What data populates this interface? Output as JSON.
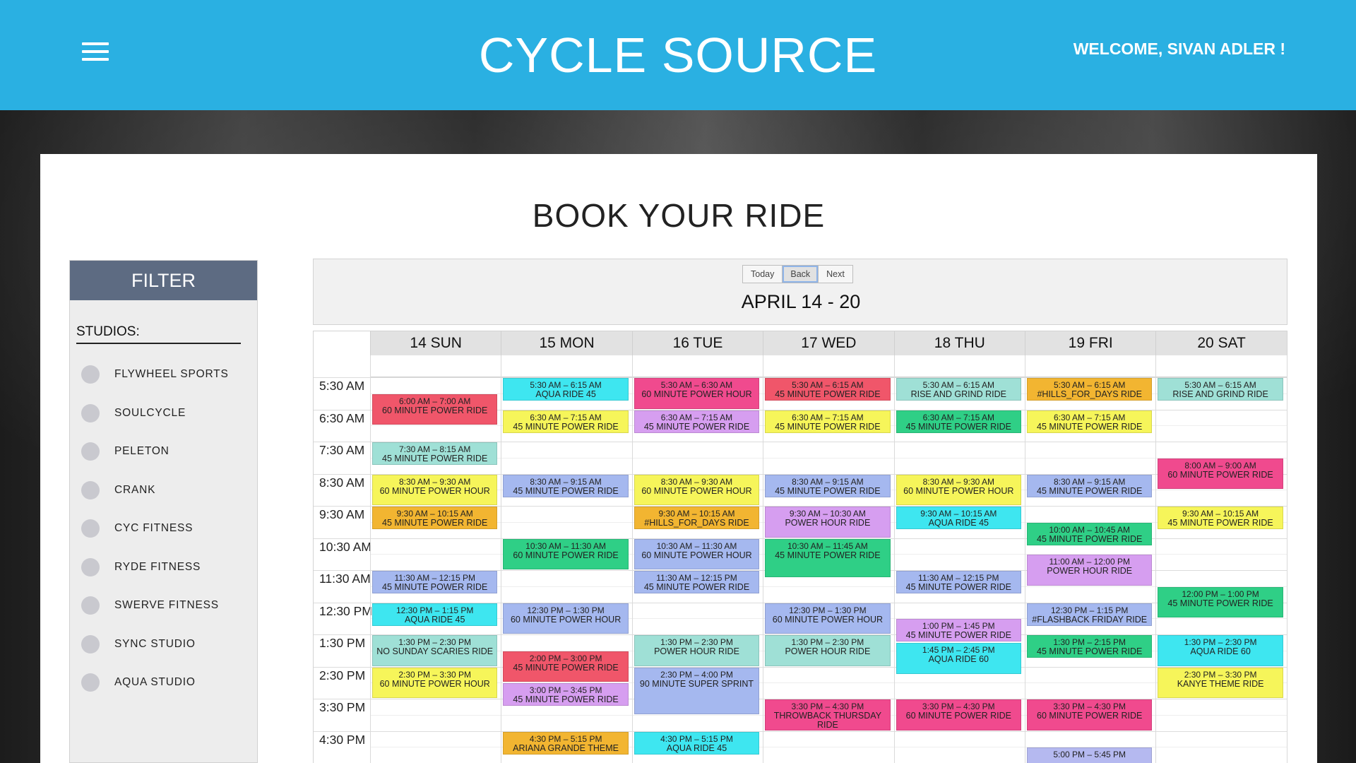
{
  "header": {
    "brand": "CYCLE SOURCE",
    "welcome": "WELCOME, SIVAN ADLER !"
  },
  "page": {
    "title": "BOOK YOUR RIDE"
  },
  "filter": {
    "heading": "FILTER",
    "studios_label": "STUDIOS:",
    "studios": [
      "FLYWHEEL SPORTS",
      "SOULCYCLE",
      "PELETON",
      "CRANK",
      "CYC FITNESS",
      "RYDE FITNESS",
      "SWERVE FITNESS",
      "SYNC STUDIO",
      "AQUA STUDIO"
    ]
  },
  "calendar": {
    "buttons": {
      "today": "Today",
      "back": "Back",
      "next": "Next"
    },
    "range": "APRIL 14 - 20",
    "days": [
      "14 SUN",
      "15 MON",
      "16 TUE",
      "17 WED",
      "18 THU",
      "19 FRI",
      "20 SAT"
    ],
    "times": [
      "5:30 AM",
      "6:30 AM",
      "7:30 AM",
      "8:30 AM",
      "9:30 AM",
      "10:30 AM",
      "11:30 AM",
      "12:30 PM",
      "1:30 PM",
      "2:30 PM",
      "3:30 PM",
      "4:30 PM"
    ],
    "colors": {
      "red": "#f0566a",
      "cyan": "#3ee6f0",
      "pink": "#f04a8e",
      "yellow": "#f6f55a",
      "orange": "#f2b531",
      "teal": "#9fe0d6",
      "green": "#2fcf86",
      "blue": "#a5b8ef",
      "purple": "#d69ef0",
      "lavender": "#b5b9f0"
    },
    "events": [
      {
        "day": 0,
        "start": 6.0,
        "end": 7.0,
        "time": "6:00 AM – 7:00 AM",
        "name": "60 MINUTE POWER RIDE",
        "color": "red"
      },
      {
        "day": 0,
        "start": 7.5,
        "end": 8.25,
        "time": "7:30 AM – 8:15 AM",
        "name": "45 MINUTE POWER RIDE",
        "color": "teal"
      },
      {
        "day": 0,
        "start": 8.5,
        "end": 9.5,
        "time": "8:30 AM – 9:30 AM",
        "name": "60 MINUTE POWER HOUR",
        "color": "yellow"
      },
      {
        "day": 0,
        "start": 9.5,
        "end": 10.25,
        "time": "9:30 AM – 10:15 AM",
        "name": "45 MINUTE POWER RIDE",
        "color": "orange"
      },
      {
        "day": 0,
        "start": 11.5,
        "end": 12.25,
        "time": "11:30 AM – 12:15 PM",
        "name": "45 MINUTE POWER RIDE",
        "color": "blue"
      },
      {
        "day": 0,
        "start": 12.5,
        "end": 13.25,
        "time": "12:30 PM – 1:15 PM",
        "name": "AQUA RIDE 45",
        "color": "cyan"
      },
      {
        "day": 0,
        "start": 13.5,
        "end": 14.5,
        "time": "1:30 PM – 2:30 PM",
        "name": "NO SUNDAY SCARIES RIDE",
        "color": "teal"
      },
      {
        "day": 0,
        "start": 14.5,
        "end": 15.5,
        "time": "2:30 PM – 3:30 PM",
        "name": "60 MINUTE POWER HOUR",
        "color": "yellow"
      },
      {
        "day": 1,
        "start": 5.5,
        "end": 6.25,
        "time": "5:30 AM – 6:15 AM",
        "name": "AQUA RIDE 45",
        "color": "cyan"
      },
      {
        "day": 1,
        "start": 6.5,
        "end": 7.25,
        "time": "6:30 AM – 7:15 AM",
        "name": "45 MINUTE POWER RIDE",
        "color": "yellow"
      },
      {
        "day": 1,
        "start": 8.5,
        "end": 9.25,
        "time": "8:30 AM – 9:15 AM",
        "name": "45 MINUTE POWER RIDE",
        "color": "blue"
      },
      {
        "day": 1,
        "start": 10.5,
        "end": 11.5,
        "time": "10:30 AM – 11:30 AM",
        "name": "60 MINUTE POWER RIDE",
        "color": "green"
      },
      {
        "day": 1,
        "start": 12.5,
        "end": 13.5,
        "time": "12:30 PM – 1:30 PM",
        "name": "60 MINUTE POWER HOUR",
        "color": "blue"
      },
      {
        "day": 1,
        "start": 14.0,
        "end": 15.0,
        "time": "2:00 PM – 3:00 PM",
        "name": "45 MINUTE POWER RIDE",
        "color": "red"
      },
      {
        "day": 1,
        "start": 15.0,
        "end": 15.75,
        "time": "3:00 PM – 3:45 PM",
        "name": "45 MINUTE POWER RIDE",
        "color": "purple"
      },
      {
        "day": 1,
        "start": 16.5,
        "end": 17.25,
        "time": "4:30 PM – 5:15 PM",
        "name": "ARIANA GRANDE THEME",
        "color": "orange"
      },
      {
        "day": 2,
        "start": 5.5,
        "end": 6.5,
        "time": "5:30 AM – 6:30 AM",
        "name": "60 MINUTE POWER HOUR",
        "color": "pink"
      },
      {
        "day": 2,
        "start": 6.5,
        "end": 7.25,
        "time": "6:30 AM – 7:15 AM",
        "name": "45 MINUTE POWER RIDE",
        "color": "purple"
      },
      {
        "day": 2,
        "start": 8.5,
        "end": 9.5,
        "time": "8:30 AM – 9:30 AM",
        "name": "60 MINUTE POWER HOUR",
        "color": "yellow"
      },
      {
        "day": 2,
        "start": 9.5,
        "end": 10.25,
        "time": "9:30 AM – 10:15 AM",
        "name": "#HILLS_FOR_DAYS RIDE",
        "color": "orange"
      },
      {
        "day": 2,
        "start": 10.5,
        "end": 11.5,
        "time": "10:30 AM – 11:30 AM",
        "name": "60 MINUTE POWER HOUR",
        "color": "blue"
      },
      {
        "day": 2,
        "start": 11.5,
        "end": 12.25,
        "time": "11:30 AM – 12:15 PM",
        "name": "45 MINUTE POWER RIDE",
        "color": "blue"
      },
      {
        "day": 2,
        "start": 13.5,
        "end": 14.5,
        "time": "1:30 PM – 2:30 PM",
        "name": "POWER HOUR RIDE",
        "color": "teal"
      },
      {
        "day": 2,
        "start": 14.5,
        "end": 16.0,
        "time": "2:30 PM – 4:00 PM",
        "name": "90 MINUTE SUPER SPRINT",
        "color": "blue"
      },
      {
        "day": 2,
        "start": 16.5,
        "end": 17.25,
        "time": "4:30 PM – 5:15 PM",
        "name": "AQUA RIDE 45",
        "color": "cyan"
      },
      {
        "day": 3,
        "start": 5.5,
        "end": 6.25,
        "time": "5:30 AM – 6:15 AM",
        "name": "45 MINUTE POWER RIDE",
        "color": "red"
      },
      {
        "day": 3,
        "start": 6.5,
        "end": 7.25,
        "time": "6:30 AM – 7:15 AM",
        "name": "45 MINUTE POWER RIDE",
        "color": "yellow"
      },
      {
        "day": 3,
        "start": 8.5,
        "end": 9.25,
        "time": "8:30 AM – 9:15 AM",
        "name": "45 MINUTE POWER RIDE",
        "color": "blue"
      },
      {
        "day": 3,
        "start": 9.5,
        "end": 10.5,
        "time": "9:30 AM – 10:30 AM",
        "name": "POWER HOUR RIDE",
        "color": "purple"
      },
      {
        "day": 3,
        "start": 10.5,
        "end": 11.75,
        "time": "10:30 AM – 11:45 AM",
        "name": "45 MINUTE POWER RIDE",
        "color": "green"
      },
      {
        "day": 3,
        "start": 12.5,
        "end": 13.5,
        "time": "12:30 PM – 1:30 PM",
        "name": "60 MINUTE POWER HOUR",
        "color": "blue"
      },
      {
        "day": 3,
        "start": 13.5,
        "end": 14.5,
        "time": "1:30 PM – 2:30 PM",
        "name": "POWER HOUR RIDE",
        "color": "teal"
      },
      {
        "day": 3,
        "start": 15.5,
        "end": 16.5,
        "time": "3:30 PM – 4:30 PM",
        "name": "THROWBACK THURSDAY RIDE",
        "color": "pink"
      },
      {
        "day": 4,
        "start": 5.5,
        "end": 6.25,
        "time": "5:30 AM – 6:15 AM",
        "name": "RISE AND GRIND RIDE",
        "color": "teal"
      },
      {
        "day": 4,
        "start": 6.5,
        "end": 7.25,
        "time": "6:30 AM – 7:15 AM",
        "name": "45 MINUTE POWER RIDE",
        "color": "green"
      },
      {
        "day": 4,
        "start": 8.5,
        "end": 9.5,
        "time": "8:30 AM – 9:30 AM",
        "name": "60 MINUTE POWER HOUR",
        "color": "yellow"
      },
      {
        "day": 4,
        "start": 9.5,
        "end": 10.25,
        "time": "9:30 AM – 10:15 AM",
        "name": "AQUA RIDE 45",
        "color": "cyan"
      },
      {
        "day": 4,
        "start": 11.5,
        "end": 12.25,
        "time": "11:30 AM – 12:15 PM",
        "name": "45 MINUTE POWER RIDE",
        "color": "blue"
      },
      {
        "day": 4,
        "start": 13.0,
        "end": 13.75,
        "time": "1:00 PM – 1:45 PM",
        "name": "45 MINUTE POWER RIDE",
        "color": "purple"
      },
      {
        "day": 4,
        "start": 13.75,
        "end": 14.75,
        "time": "1:45 PM – 2:45 PM",
        "name": "AQUA RIDE 60",
        "color": "cyan"
      },
      {
        "day": 4,
        "start": 15.5,
        "end": 16.5,
        "time": "3:30 PM – 4:30 PM",
        "name": "60 MINUTE POWER RIDE",
        "color": "pink"
      },
      {
        "day": 5,
        "start": 5.5,
        "end": 6.25,
        "time": "5:30 AM – 6:15 AM",
        "name": "#HILLS_FOR_DAYS RIDE",
        "color": "orange"
      },
      {
        "day": 5,
        "start": 6.5,
        "end": 7.25,
        "time": "6:30 AM – 7:15 AM",
        "name": "45 MINUTE POWER RIDE",
        "color": "yellow"
      },
      {
        "day": 5,
        "start": 8.5,
        "end": 9.25,
        "time": "8:30 AM – 9:15 AM",
        "name": "45 MINUTE POWER RIDE",
        "color": "blue"
      },
      {
        "day": 5,
        "start": 10.0,
        "end": 10.75,
        "time": "10:00 AM – 10:45 AM",
        "name": "45 MINUTE POWER RIDE",
        "color": "green"
      },
      {
        "day": 5,
        "start": 11.0,
        "end": 12.0,
        "time": "11:00 AM – 12:00 PM",
        "name": "POWER HOUR RIDE",
        "color": "purple"
      },
      {
        "day": 5,
        "start": 12.5,
        "end": 13.25,
        "time": "12:30 PM – 1:15 PM",
        "name": "#FLASHBACK FRIDAY RIDE",
        "color": "blue"
      },
      {
        "day": 5,
        "start": 13.5,
        "end": 14.25,
        "time": "1:30 PM – 2:15 PM",
        "name": "45 MINUTE POWER RIDE",
        "color": "green"
      },
      {
        "day": 5,
        "start": 15.5,
        "end": 16.5,
        "time": "3:30 PM – 4:30 PM",
        "name": "60 MINUTE POWER RIDE",
        "color": "pink"
      },
      {
        "day": 5,
        "start": 17.0,
        "end": 17.75,
        "time": "5:00 PM – 5:45 PM",
        "name": "",
        "color": "lavender"
      },
      {
        "day": 6,
        "start": 5.5,
        "end": 6.25,
        "time": "5:30 AM – 6:15 AM",
        "name": "RISE AND GRIND RIDE",
        "color": "teal"
      },
      {
        "day": 6,
        "start": 8.0,
        "end": 9.0,
        "time": "8:00 AM – 9:00 AM",
        "name": "60 MINUTE POWER RIDE",
        "color": "pink"
      },
      {
        "day": 6,
        "start": 9.5,
        "end": 10.25,
        "time": "9:30 AM – 10:15 AM",
        "name": "45 MINUTE POWER RIDE",
        "color": "yellow"
      },
      {
        "day": 6,
        "start": 12.0,
        "end": 13.0,
        "time": "12:00 PM – 1:00 PM",
        "name": "45 MINUTE POWER RIDE",
        "color": "green"
      },
      {
        "day": 6,
        "start": 13.5,
        "end": 14.5,
        "time": "1:30 PM – 2:30 PM",
        "name": "AQUA RIDE 60",
        "color": "cyan"
      },
      {
        "day": 6,
        "start": 14.5,
        "end": 15.5,
        "time": "2:30 PM – 3:30 PM",
        "name": "KANYE THEME RIDE",
        "color": "yellow"
      }
    ]
  }
}
